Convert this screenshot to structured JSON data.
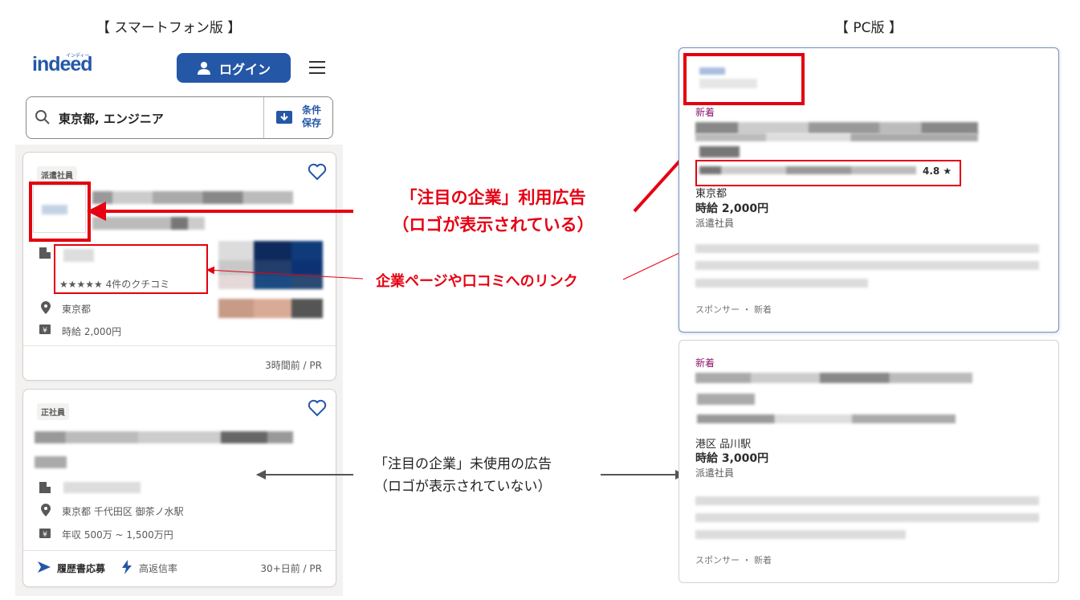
{
  "headings": {
    "mobile": "【 スマートフォン版 】",
    "pc": "【 PC版 】"
  },
  "mobile": {
    "logo": "indeed",
    "logo_sub": "インディード",
    "login_label": "ログイン",
    "search_value": "東京都, エンジニア",
    "save_search_label_1": "条件",
    "save_search_label_2": "保存",
    "card1": {
      "tag": "派遣社員",
      "rating_stars": "★★★★★",
      "review_count": "4件のクチコミ",
      "location": "東京都",
      "salary": "時給 2,000円",
      "posted": "3時間前 / PR"
    },
    "card2": {
      "tag": "正社員",
      "location": "東京都 千代田区 御茶ノ水駅",
      "salary": "年収 500万 ~ 1,500万円",
      "apply_label": "履歴書応募",
      "response_label": "高返信率",
      "posted": "30+日前 / PR"
    }
  },
  "annotations": {
    "featured_line1": "「注目の企業」利用広告",
    "featured_line2": "（ロゴが表示されている）",
    "links": "企業ページや口コミへのリンク",
    "unfeatured_line1": "「注目の企業」未使用の広告",
    "unfeatured_line2": "（ロゴが表示されていない）"
  },
  "pc": {
    "card1": {
      "new_label": "新着",
      "rating": "4.8 ★",
      "location": "東京都",
      "salary": "時給 2,000円",
      "job_type": "派遣社員",
      "footer": "スポンサー ・ 新着"
    },
    "card2": {
      "new_label": "新着",
      "location": "港区 品川駅",
      "salary": "時給 3,000円",
      "job_type": "派遣社員",
      "footer": "スポンサー ・ 新着"
    }
  },
  "colors": {
    "brand": "#2557a7",
    "annotation_red": "#e60012",
    "new_label": "#8b1a6b"
  }
}
